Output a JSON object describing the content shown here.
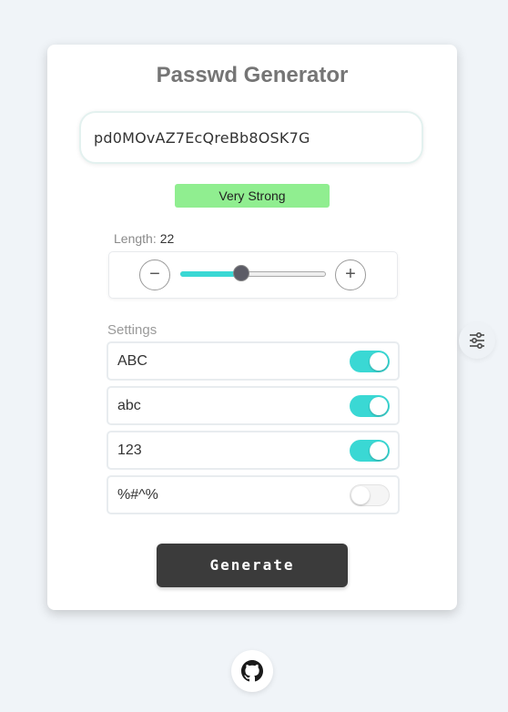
{
  "app": {
    "title": "Passwd Generator"
  },
  "password": {
    "value": "pd0MOvAZ7EcQreBb8OSK7G"
  },
  "strength": {
    "label": "Very Strong",
    "color": "#90ee90"
  },
  "length": {
    "label": "Length:",
    "value": "22",
    "slider_fraction": 0.42,
    "decrement_symbol": "−",
    "increment_symbol": "+"
  },
  "settings": {
    "label": "Settings",
    "items": [
      {
        "label": "ABC",
        "enabled": true
      },
      {
        "label": "abc",
        "enabled": true
      },
      {
        "label": "123",
        "enabled": true
      },
      {
        "label": "%#^%",
        "enabled": false
      }
    ]
  },
  "actions": {
    "generate_label": "Generate"
  },
  "icons": {
    "side": "sliders-icon",
    "footer": "github-icon"
  },
  "colors": {
    "accent": "#3ad8d4",
    "button": "#3b3b3b"
  }
}
